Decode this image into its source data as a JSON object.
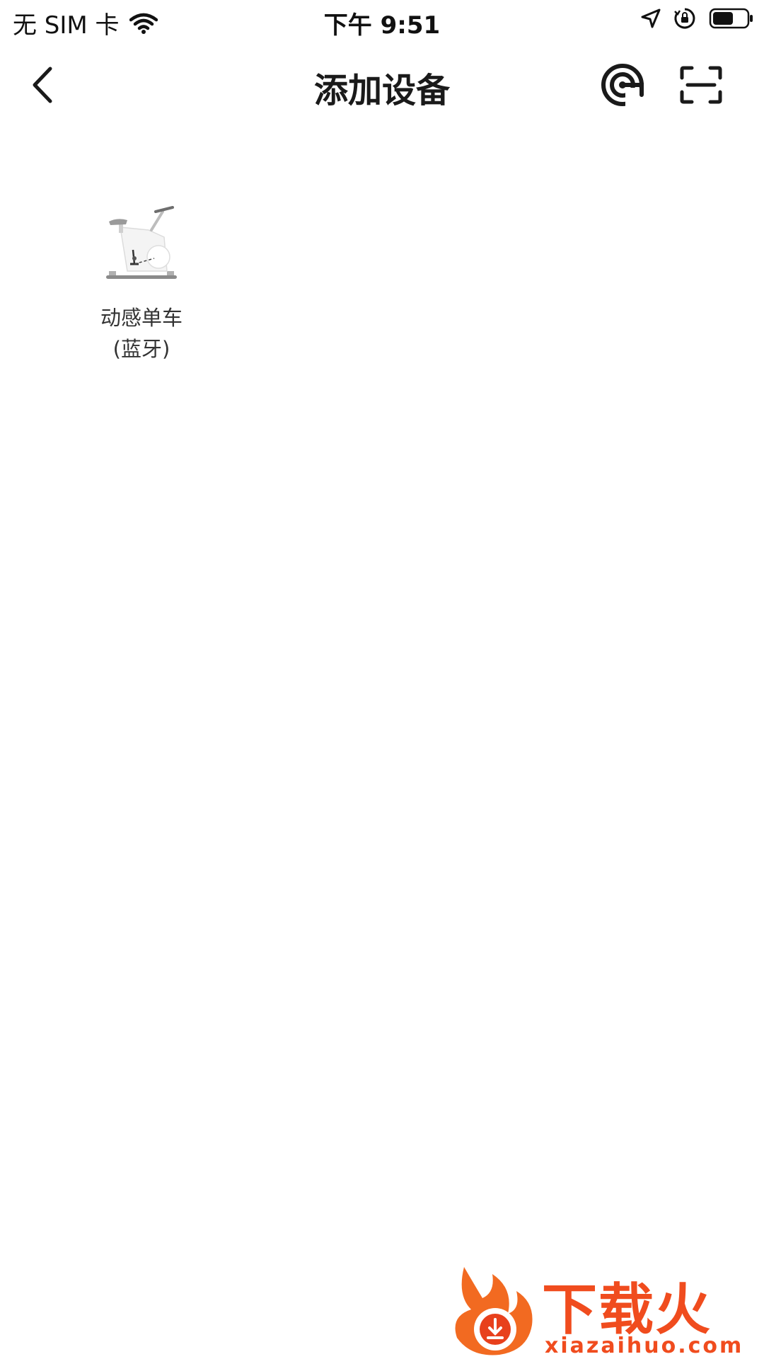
{
  "status_bar": {
    "carrier": "无 SIM 卡",
    "time": "下午 9:51"
  },
  "nav": {
    "title": "添加设备",
    "icons": [
      "back-icon",
      "radar-icon",
      "scan-icon"
    ]
  },
  "devices": [
    {
      "name_line1": "动感单车",
      "name_line2": "(蓝牙)",
      "icon": "spin-bike-image"
    }
  ],
  "watermark": {
    "text": "下载火",
    "domain": "xiazaihuo.com"
  },
  "colors": {
    "accent": "#f04c1e",
    "text": "#1a1a1a",
    "background": "#ffffff"
  }
}
